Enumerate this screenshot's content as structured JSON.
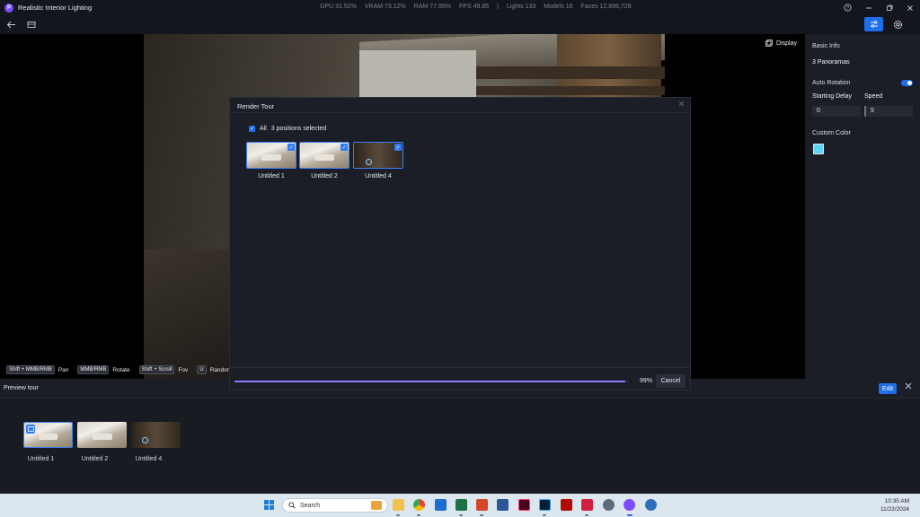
{
  "app": {
    "title": "Realistic Interior Lighting",
    "stats": [
      "GPU 31.52%",
      "VRAM 73.12%",
      "RAM 77.95%",
      "FPS 49.85",
      "|",
      "Lights 133",
      "Models 16",
      "Faces 12,896,728"
    ]
  },
  "icons": {
    "help": "?",
    "minimize": "—",
    "maximize": "▢",
    "close": "✕",
    "back": "←",
    "settings": "⚙"
  },
  "viewport": {
    "display_label": "Display",
    "hints": [
      {
        "key": "Shift + MMB/RMB",
        "label": "Pan"
      },
      {
        "key": "MMB/RMB",
        "label": "Rotate"
      },
      {
        "key": "Shift + Scroll",
        "label": "Fov"
      },
      {
        "key": "U",
        "label": "Random Place"
      }
    ]
  },
  "right_panel": {
    "basic_info": "Basic Info",
    "panoramas": "3 Panoramas",
    "auto_rotation": "Auto Rotation",
    "auto_rotation_on": true,
    "starting_delay_label": "Starting Delay",
    "speed_label": "Speed",
    "starting_delay_value": "0",
    "speed_value": "5",
    "custom_color_label": "Custom Color",
    "custom_color": "#5fd3f5"
  },
  "modal": {
    "title": "Render Tour",
    "all_label": "All",
    "selected_label": "3 positions selected",
    "positions": [
      {
        "label": "Untitled 1",
        "style": "bright"
      },
      {
        "label": "Untitled 2",
        "style": "bright"
      },
      {
        "label": "Untitled 4",
        "style": "dark"
      }
    ],
    "progress": 0.99,
    "progress_label": "99%",
    "cancel_label": "Cancel"
  },
  "preview": {
    "title": "Preview tour",
    "edit_label": "Edit",
    "items": [
      {
        "label": "Untitled 1"
      },
      {
        "label": "Untitled 2"
      },
      {
        "label": "Untitled 4"
      }
    ]
  },
  "taskbar": {
    "search_placeholder": "Search",
    "time": "10:35 AM",
    "date": "11/22/2024"
  },
  "colors": {
    "accent": "#1f6feb",
    "progress": "#8b7bff",
    "app_logo": "#7b4cff"
  }
}
